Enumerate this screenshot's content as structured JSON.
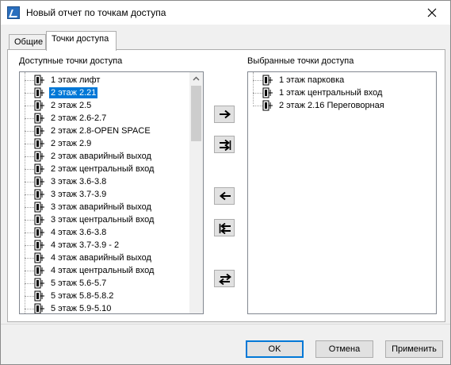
{
  "window": {
    "title": "Новый отчет по точкам доступа"
  },
  "tabs": [
    {
      "label": "Общие"
    },
    {
      "label": "Точки доступа"
    }
  ],
  "available": {
    "label": "Доступные точки доступа",
    "items": [
      "1 этаж лифт",
      "2 этаж 2.21",
      "2 этаж 2.5",
      "2 этаж 2.6-2.7",
      "2 этаж 2.8-OPEN SPACE",
      "2 этаж 2.9",
      "2 этаж аварийный выход",
      "2 этаж центральный вход",
      "3 этаж 3.6-3.8",
      "3 этаж 3.7-3.9",
      "3 этаж аварийный выход",
      "3 этаж центральный вход",
      "4 этаж 3.6-3.8",
      "4 этаж 3.7-3.9 - 2",
      "4 этаж аварийный выход",
      "4 этаж центральный вход",
      "5 этаж 5.6-5.7",
      "5 этаж 5.8-5.8.2",
      "5 этаж 5.9-5.10"
    ],
    "selected_index": 1
  },
  "selected": {
    "label": "Выбранные точки доступа",
    "items": [
      "1 этаж парковка",
      "1 этаж центральный вход",
      "2 этаж 2.16 Переговорная"
    ]
  },
  "buttons": {
    "ok": "OK",
    "cancel": "Отмена",
    "apply": "Применить"
  },
  "colors": {
    "selection": "#0078d7",
    "default_button_border": "#0078d7"
  }
}
